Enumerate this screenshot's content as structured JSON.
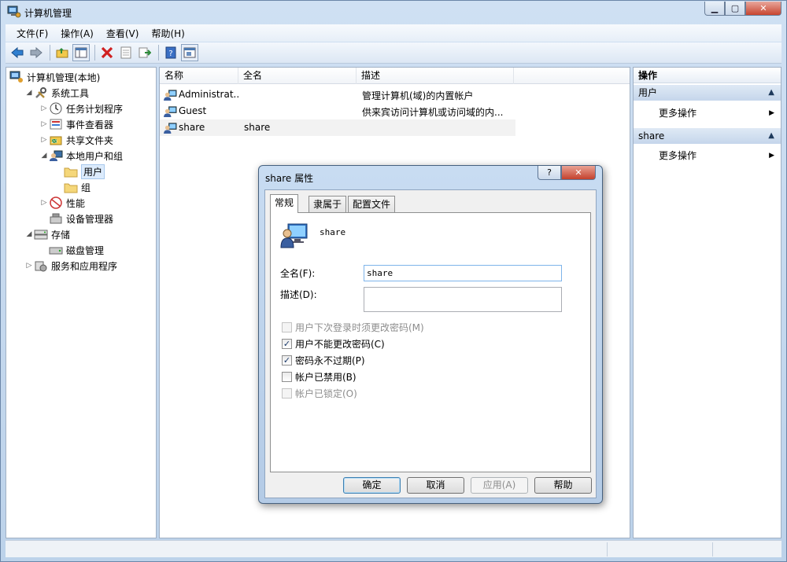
{
  "window": {
    "title": "计算机管理"
  },
  "menu": [
    "文件(F)",
    "操作(A)",
    "查看(V)",
    "帮助(H)"
  ],
  "tree": {
    "items": [
      {
        "label": "计算机管理(本地)",
        "indent": 0,
        "arrow": "",
        "icon": "computer-management-icon"
      },
      {
        "label": "系统工具",
        "indent": 1,
        "arrow": "▲",
        "icon": "tools-icon"
      },
      {
        "label": "任务计划程序",
        "indent": 2,
        "arrow": "▷",
        "icon": "clock-icon"
      },
      {
        "label": "事件查看器",
        "indent": 2,
        "arrow": "▷",
        "icon": "event-viewer-icon"
      },
      {
        "label": "共享文件夹",
        "indent": 2,
        "arrow": "▷",
        "icon": "shared-folder-icon"
      },
      {
        "label": "本地用户和组",
        "indent": 2,
        "arrow": "▲",
        "icon": "users-groups-icon"
      },
      {
        "label": "用户",
        "indent": 3,
        "arrow": "",
        "icon": "folder-icon",
        "selected": true
      },
      {
        "label": "组",
        "indent": 3,
        "arrow": "",
        "icon": "folder-icon"
      },
      {
        "label": "性能",
        "indent": 2,
        "arrow": "▷",
        "icon": "performance-icon"
      },
      {
        "label": "设备管理器",
        "indent": 2,
        "arrow": "",
        "icon": "device-manager-icon"
      },
      {
        "label": "存储",
        "indent": 1,
        "arrow": "▲",
        "icon": "storage-icon"
      },
      {
        "label": "磁盘管理",
        "indent": 2,
        "arrow": "",
        "icon": "disk-icon"
      },
      {
        "label": "服务和应用程序",
        "indent": 1,
        "arrow": "▷",
        "icon": "services-icon"
      }
    ]
  },
  "list": {
    "columns": [
      "名称",
      "全名",
      "描述"
    ],
    "rows": [
      {
        "name": "Administrat...",
        "fullname": "",
        "desc": "管理计算机(域)的内置帐户"
      },
      {
        "name": "Guest",
        "fullname": "",
        "desc": "供来宾访问计算机或访问域的内..."
      },
      {
        "name": "share",
        "fullname": "share",
        "desc": ""
      }
    ]
  },
  "actions": {
    "title": "操作",
    "sections": [
      {
        "header": "用户",
        "item": "更多操作"
      },
      {
        "header": "share",
        "item": "更多操作"
      }
    ]
  },
  "dialog": {
    "title": "share 属性",
    "help_glyph": "?",
    "close_glyph": "✕",
    "tabs": [
      "常规",
      "隶属于",
      "配置文件"
    ],
    "username": "share",
    "fullname_label": "全名(F):",
    "fullname_value": "share",
    "desc_label": "描述(D):",
    "desc_value": "",
    "checkboxes": [
      {
        "label": "用户下次登录时须更改密码(M)",
        "checked": false,
        "disabled": true
      },
      {
        "label": "用户不能更改密码(C)",
        "checked": true,
        "disabled": false
      },
      {
        "label": "密码永不过期(P)",
        "checked": true,
        "disabled": false
      },
      {
        "label": "帐户已禁用(B)",
        "checked": false,
        "disabled": false
      },
      {
        "label": "帐户已锁定(O)",
        "checked": false,
        "disabled": true
      }
    ],
    "buttons": {
      "ok": "确定",
      "cancel": "取消",
      "apply": "应用(A)",
      "help": "帮助"
    }
  }
}
